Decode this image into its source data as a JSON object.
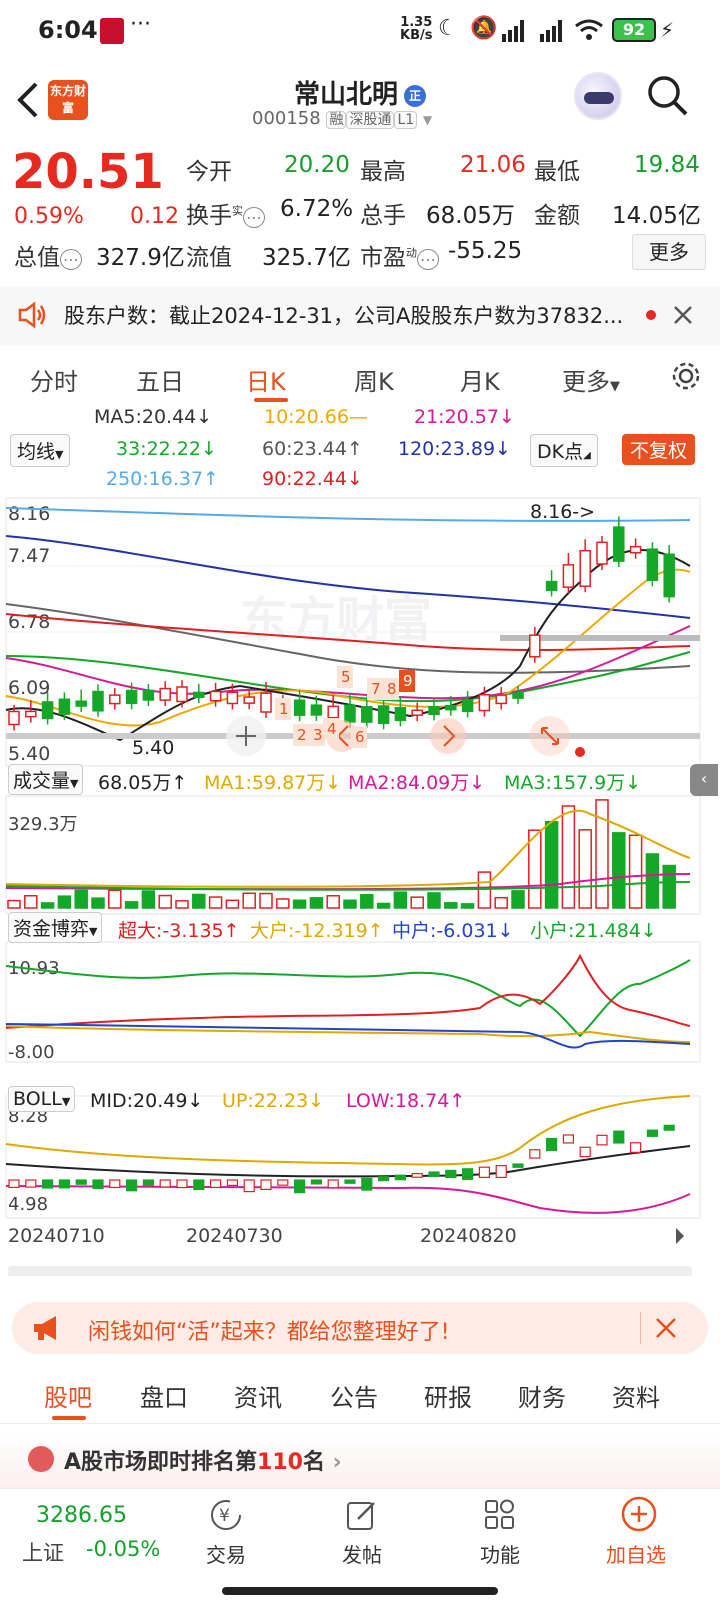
{
  "status": {
    "time": "6:04",
    "net_speed_val": "1.35",
    "net_speed_unit": "KB/s",
    "battery": "92",
    "more": "···"
  },
  "header": {
    "title": "常山北明",
    "badge": "正",
    "code": "000158",
    "tags": [
      "融",
      "深股通",
      "L1"
    ],
    "logo": "东方财富"
  },
  "quote": {
    "price": "20.51",
    "change_pct": "0.59%",
    "change": "0.12",
    "row1": [
      {
        "label": "今开",
        "value": "20.20",
        "color": "green"
      },
      {
        "label": "最高",
        "value": "21.06",
        "color": "red"
      },
      {
        "label": "最低",
        "value": "19.84",
        "color": "green"
      }
    ],
    "row2": [
      {
        "label": "换手",
        "sup": "实",
        "value": "6.72%"
      },
      {
        "label": "总手",
        "value": "68.05万"
      },
      {
        "label": "金额",
        "value": "14.05亿"
      }
    ],
    "row3": [
      {
        "label": "总值",
        "value": "327.9亿"
      },
      {
        "label": "流值",
        "value": "325.7亿"
      },
      {
        "label": "市盈",
        "sup": "动",
        "value": "-55.25"
      }
    ],
    "more_btn": "更多"
  },
  "notice": {
    "text": "股东户数：截止2024-12-31，公司A股股东户数为37832..."
  },
  "chart_tabs": [
    "分时",
    "五日",
    "日K",
    "周K",
    "月K",
    "更多"
  ],
  "active_tab": "日K",
  "ma_legend": {
    "type_btn": "均线",
    "dk_btn": "DK点",
    "fq_btn": "不复权",
    "items": [
      {
        "text": "MA5:20.44↓",
        "color": "#333333"
      },
      {
        "text": "10:20.66—",
        "color": "#f0a800"
      },
      {
        "text": "21:20.57↓",
        "color": "#d6189a"
      },
      {
        "text": "33:22.22↓",
        "color": "#15a828"
      },
      {
        "text": "60:23.44↑",
        "color": "#555555"
      },
      {
        "text": "120:23.89↓",
        "color": "#2233aa"
      },
      {
        "text": "250:16.37↑",
        "color": "#55aaee"
      },
      {
        "text": "90:22.44↓",
        "color": "#e02020"
      }
    ]
  },
  "kline": {
    "y_labels": [
      "8.16",
      "7.47",
      "6.78",
      "6.09",
      "5.40"
    ],
    "high_marker": "8.16->",
    "low_marker": "5.40",
    "watermark": "东方财富",
    "numbers": [
      "1",
      "2",
      "3",
      "4",
      "5",
      "6",
      "7",
      "8",
      "9"
    ]
  },
  "volume": {
    "label": "成交量",
    "items": [
      {
        "text": "68.05万↑",
        "color": "#222222"
      },
      {
        "text": "MA1:59.87万↓",
        "color": "#e0a800"
      },
      {
        "text": "MA2:84.09万↓",
        "color": "#d6189a"
      },
      {
        "text": "MA3:157.9万↓",
        "color": "#15a828"
      }
    ],
    "y_label": "329.3万"
  },
  "capital": {
    "label": "资金博弈",
    "items": [
      {
        "text": "超大:-3.135↑",
        "color": "#e02020"
      },
      {
        "text": "大户:-12.319↑",
        "color": "#e0a800"
      },
      {
        "text": "中户:-6.031↓",
        "color": "#2244cc"
      },
      {
        "text": "小户:21.484↓",
        "color": "#15a828"
      }
    ],
    "y_top": "10.93",
    "y_bottom": "-8.00"
  },
  "boll": {
    "label": "BOLL",
    "items": [
      {
        "text": "MID:20.49↓",
        "color": "#222222"
      },
      {
        "text": "UP:22.23↓",
        "color": "#e0a800"
      },
      {
        "text": "LOW:18.74↑",
        "color": "#d6189a"
      }
    ],
    "y_top": "8.28",
    "y_bottom": "4.98"
  },
  "dates": [
    "20240710",
    "20240730",
    "20240820"
  ],
  "promo": {
    "text": "闲钱如何“活”起来？都给您整理好了!"
  },
  "sub_tabs": [
    "股吧",
    "盘口",
    "资讯",
    "公告",
    "研报",
    "财务",
    "资料"
  ],
  "active_sub_tab": "股吧",
  "peek": {
    "text_a": "A股市场即时排名第",
    "rank": "110",
    "text_b": "名"
  },
  "bottom": {
    "index_value": "3286.65",
    "index_name": "上证",
    "index_change": "-0.05%",
    "buttons": [
      "交易",
      "发帖",
      "功能",
      "加自选"
    ]
  }
}
